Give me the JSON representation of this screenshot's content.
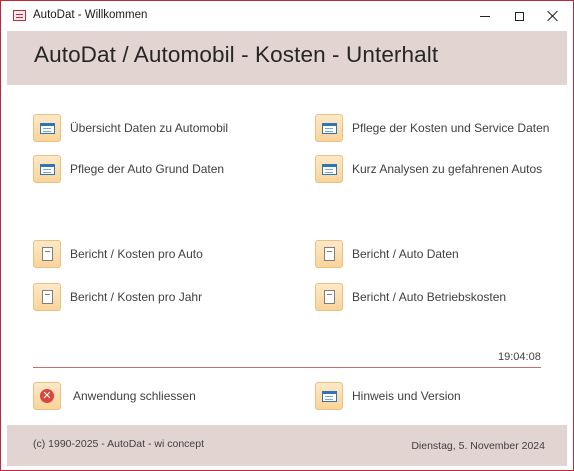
{
  "window": {
    "title": "AutoDat - Willkommen"
  },
  "header": {
    "title": "AutoDat / Automobil - Kosten - Unterhalt"
  },
  "menu": {
    "uebersicht": "Übersicht Daten zu Automobil",
    "pflege_kosten": "Pflege der Kosten und Service Daten",
    "pflege_grund": "Pflege der Auto Grund Daten",
    "kurz_analysen": "Kurz Analysen zu gefahrenen Autos",
    "bericht_kosten_auto": "Bericht / Kosten pro Auto",
    "bericht_auto_daten": "Bericht / Auto Daten",
    "bericht_kosten_jahr": "Bericht / Kosten pro Jahr",
    "bericht_betriebskosten": "Bericht / Auto Betriebskosten",
    "schliessen": "Anwendung schliessen",
    "hinweis": "Hinweis und Version"
  },
  "status": {
    "time": "19:04:08"
  },
  "footer": {
    "copyright": "(c) 1990-2025 - AutoDat - wi concept",
    "date": "Dienstag, 5. November 2024"
  },
  "colors": {
    "header_bg": "#e2d5d1",
    "window_border": "#c0283c",
    "button_bg": "#f9d49a",
    "divider": "#c46e6e"
  },
  "icons": {
    "form": "form-icon",
    "report": "report-icon",
    "exit": "exit-icon"
  }
}
